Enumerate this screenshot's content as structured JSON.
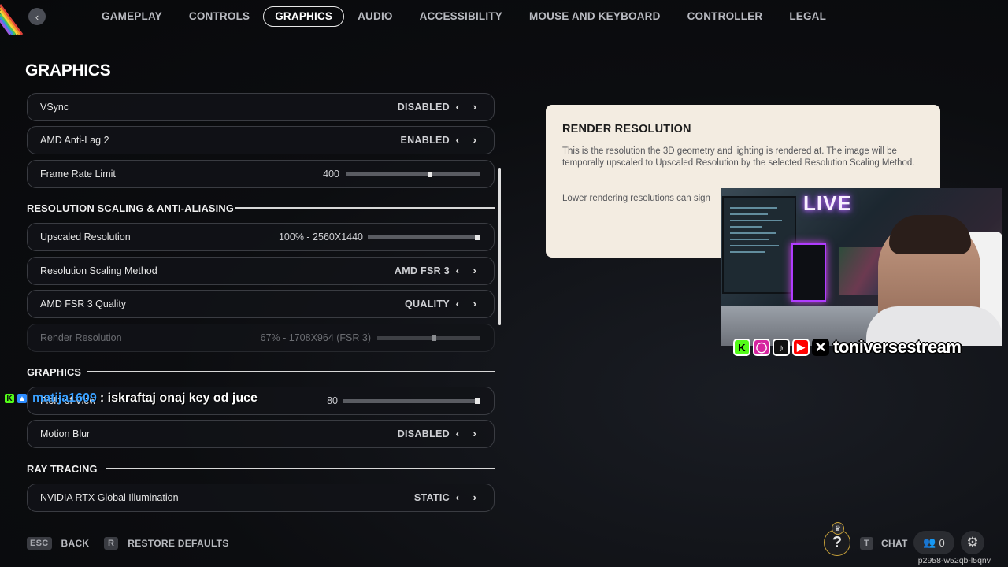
{
  "nav": {
    "back_icon": "chevron-left-icon",
    "tabs": [
      {
        "label": "GAMEPLAY"
      },
      {
        "label": "CONTROLS"
      },
      {
        "label": "GRAPHICS",
        "active": true
      },
      {
        "label": "AUDIO"
      },
      {
        "label": "ACCESSIBILITY"
      },
      {
        "label": "MOUSE AND KEYBOARD"
      },
      {
        "label": "CONTROLLER"
      },
      {
        "label": "LEGAL"
      }
    ]
  },
  "page_title": "GRAPHICS",
  "settings": {
    "vsync": {
      "label": "VSync",
      "value": "DISABLED"
    },
    "antilag": {
      "label": "AMD Anti-Lag 2",
      "value": "ENABLED"
    },
    "framerate": {
      "label": "Frame Rate Limit",
      "value": "400",
      "level": 0.63
    },
    "section_scaling": "RESOLUTION SCALING & ANTI-ALIASING",
    "upscaled": {
      "label": "Upscaled Resolution",
      "value": "100% - 2560X1440",
      "level": 1.0
    },
    "scaling_method": {
      "label": "Resolution Scaling Method",
      "value": "AMD FSR 3"
    },
    "fsr_quality": {
      "label": "AMD FSR 3 Quality",
      "value": "QUALITY"
    },
    "render_res": {
      "label": "Render Resolution",
      "value": "67% - 1708X964 (FSR 3)",
      "level": 0.55
    },
    "section_graphics": "GRAPHICS",
    "fov": {
      "label": "Field of View",
      "value": "80",
      "level": 1.0
    },
    "motion_blur": {
      "label": "Motion Blur",
      "value": "DISABLED"
    },
    "section_rt": "RAY TRACING",
    "rtgi": {
      "label": "NVIDIA RTX Global Illumination",
      "value": "STATIC"
    }
  },
  "info_panel": {
    "title": "RENDER RESOLUTION",
    "para1": "This is the resolution the 3D geometry and lighting is rendered at. The image will be temporally upscaled to Upscaled Resolution by the selected Resolution Scaling Method.",
    "para2": "Lower rendering resolutions can sign"
  },
  "stream": {
    "live_text": "LIVE",
    "handle": "toniversestream",
    "chat_user": "matija1609",
    "chat_message": ": iskraftaj onaj key od juce"
  },
  "bottom": {
    "back_key": "ESC",
    "back_label": "BACK",
    "restore_key": "R",
    "restore_label": "RESTORE DEFAULTS",
    "chat_key": "T",
    "chat_label": "CHAT",
    "friends_count": "0",
    "session_id": "p2958-w52qb-l5qnv"
  },
  "colors": {
    "accent": "#e8e8e8",
    "panel_bg": "#f3ece1",
    "chat_user": "#3aa0ff"
  }
}
